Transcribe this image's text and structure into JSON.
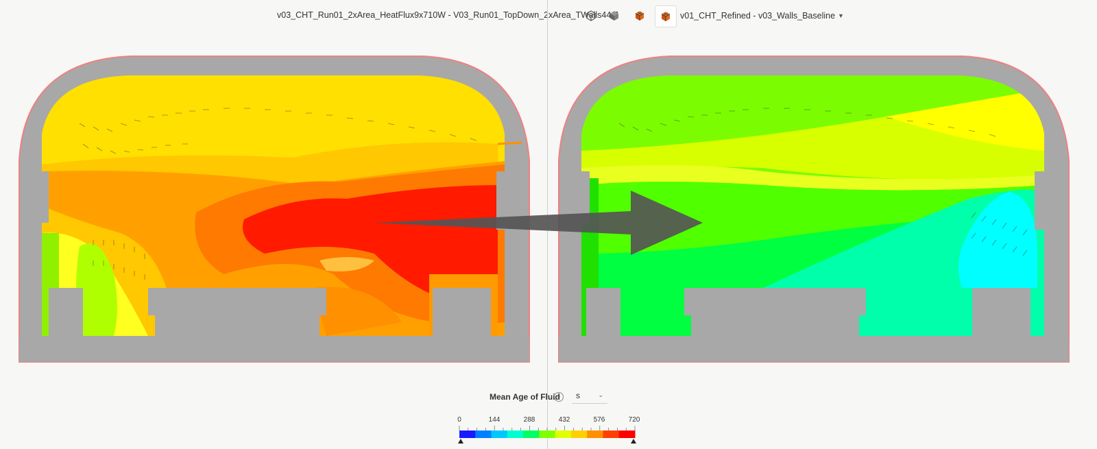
{
  "toolbar": {
    "left_simulation_label": "v03_CHT_Run01_2xArea_HeatFlux9x710W - V03_Run01_TopDown_2xArea_TWalls44.7",
    "right_simulation_label": "v01_CHT_Refined - v03_Walls_Baseline",
    "icons": [
      "cube-outline-icon",
      "cube-solid-icon",
      "mesh-cube-icon",
      "mesh-cube-active-icon"
    ]
  },
  "legend": {
    "title": "Mean Age of Fluid",
    "unit": "s",
    "min": "0",
    "max": "720",
    "tick_labels": [
      "0",
      "144",
      "288",
      "432",
      "576",
      "720"
    ],
    "colors": [
      "#1a1aff",
      "#0080ff",
      "#00c8ff",
      "#00ffd0",
      "#00ff60",
      "#80ff00",
      "#e0ff00",
      "#ffd000",
      "#ff9000",
      "#ff4000",
      "#ff0000"
    ]
  },
  "overlay": {
    "arrow": "comparison-arrow"
  }
}
